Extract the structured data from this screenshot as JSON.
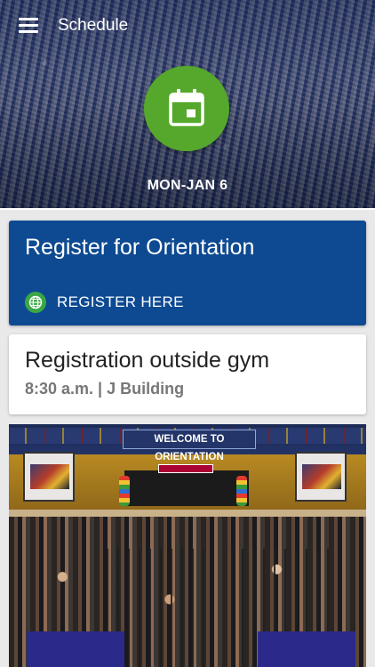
{
  "app": {
    "title": "Schedule"
  },
  "header": {
    "date": "MON-JAN 6"
  },
  "register_card": {
    "title": "Register for Orientation",
    "link_label": "REGISTER HERE"
  },
  "event_card": {
    "title": "Registration outside gym",
    "details": "8:30 a.m. | J Building"
  },
  "photo": {
    "banner_text": "WELCOME TO ORIENTATION",
    "stage_sign": "WELCOME!"
  },
  "icons": {
    "menu": "hamburger-menu-icon",
    "calendar": "calendar-icon",
    "globe": "globe-icon"
  },
  "colors": {
    "accent_green": "#55a82b",
    "card_blue": "#0e4a92",
    "link_green": "#3aa745"
  }
}
